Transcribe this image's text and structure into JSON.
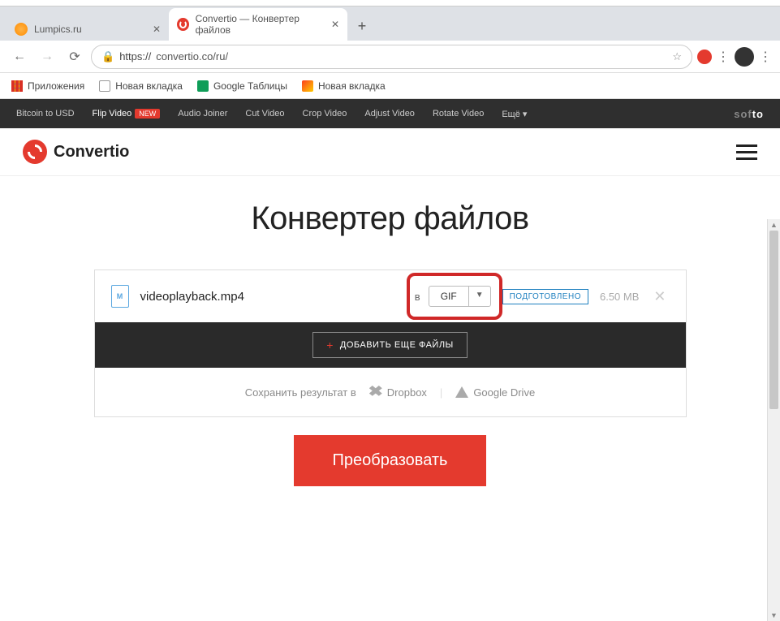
{
  "browser": {
    "tabs": [
      {
        "title": "Lumpics.ru",
        "active": false
      },
      {
        "title": "Convertio — Конвертер файлов",
        "active": true
      }
    ],
    "url_scheme": "https://",
    "url_rest": "convertio.co/ru/"
  },
  "bookmarks": {
    "apps": "Приложения",
    "newtab1": "Новая вкладка",
    "sheets": "Google Таблицы",
    "newtab2": "Новая вкладка"
  },
  "softo": {
    "items": [
      "Bitcoin to USD",
      "Flip Video",
      "Audio Joiner",
      "Cut Video",
      "Crop Video",
      "Adjust Video",
      "Rotate Video"
    ],
    "new_badge": "NEW",
    "more": "Ещё",
    "brand_light": "sof",
    "brand_bold": "to"
  },
  "header": {
    "logo_text": "Convertio"
  },
  "main": {
    "title": "Конвертер файлов",
    "file": {
      "icon_letter": "M",
      "name": "videoplayback.mp4",
      "in_label": "в",
      "format": "GIF",
      "status": "ПОДГОТОВЛЕНО",
      "size": "6.50 MB"
    },
    "add_more": "ДОБАВИТЬ ЕЩЕ ФАЙЛЫ",
    "save_label": "Сохранить результат в",
    "dropbox": "Dropbox",
    "gdrive": "Google Drive",
    "convert": "Преобразовать"
  }
}
